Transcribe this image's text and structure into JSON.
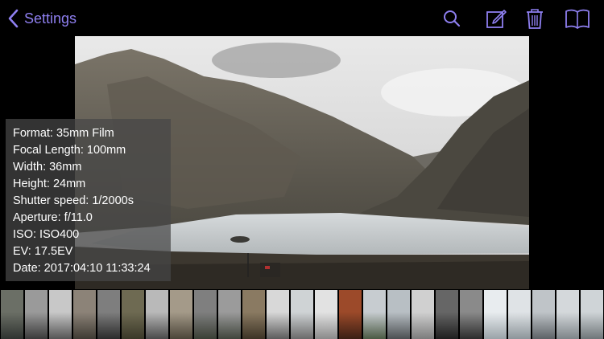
{
  "nav": {
    "back_label": "Settings"
  },
  "toolbar": {
    "icons": [
      "search-icon",
      "edit-icon",
      "trash-icon",
      "book-icon"
    ]
  },
  "colors": {
    "accent": "#8e7ff0",
    "background": "#000000",
    "overlay": "#464646"
  },
  "info": {
    "lines": [
      "Format: 35mm Film",
      "Focal Length: 100mm",
      "Width: 36mm",
      "Height: 24mm",
      "Shutter speed: 1/2000s",
      "Aperture: f/11.0",
      "ISO: ISO400",
      "EV: 17.5EV",
      "Date: 2017:04:10 11:33:24"
    ]
  },
  "thumbnails": {
    "count": 25
  }
}
